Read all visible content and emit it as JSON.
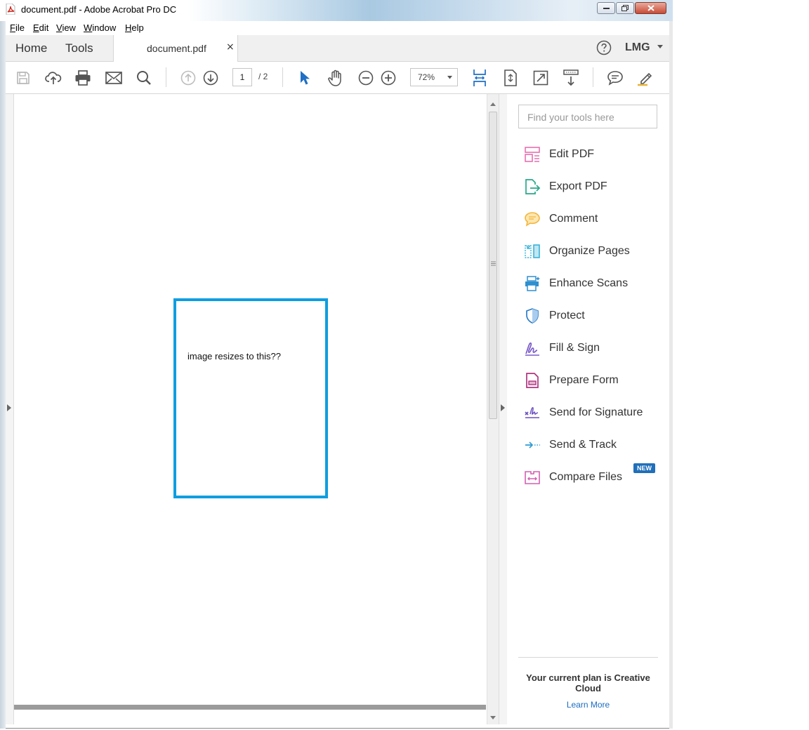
{
  "window": {
    "title": "document.pdf - Adobe Acrobat Pro DC"
  },
  "menu": [
    "File",
    "Edit",
    "View",
    "Window",
    "Help"
  ],
  "tabs": {
    "home": "Home",
    "tools": "Tools",
    "document_tab": "document.pdf",
    "close_glyph": "×",
    "user": "LMG"
  },
  "toolbar": {
    "page_current": "1",
    "page_total": "/ 2",
    "zoom": "72%",
    "icons": [
      "save-icon",
      "cloud-upload-icon",
      "print-icon",
      "email-icon",
      "search-icon",
      "page-up-icon",
      "page-down-icon",
      "select-arrow-icon",
      "hand-icon",
      "zoom-out-icon",
      "zoom-in-icon",
      "fit-width-icon",
      "fit-page-icon",
      "full-screen-icon",
      "scroll-mode-icon",
      "comment-icon",
      "highlight-pen-icon"
    ]
  },
  "document": {
    "page_text": "image resizes to this??",
    "frame_color": "#0e9ee0"
  },
  "tools_pane": {
    "search_placeholder": "Find your tools here",
    "items": [
      {
        "label": "Edit PDF",
        "icon": "edit-pdf-icon",
        "color": "#e86fb1"
      },
      {
        "label": "Export PDF",
        "icon": "export-pdf-icon",
        "color": "#2aa88a"
      },
      {
        "label": "Comment",
        "icon": "comment-bubble-icon",
        "color": "#f3b53c"
      },
      {
        "label": "Organize Pages",
        "icon": "organize-pages-icon",
        "color": "#3ab3d9"
      },
      {
        "label": "Enhance Scans",
        "icon": "enhance-scans-icon",
        "color": "#2f8fcf"
      },
      {
        "label": "Protect",
        "icon": "shield-icon",
        "color": "#2c7dc8"
      },
      {
        "label": "Fill & Sign",
        "icon": "fill-sign-icon",
        "color": "#7a5cc8"
      },
      {
        "label": "Prepare Form",
        "icon": "prepare-form-icon",
        "color": "#b0347f"
      },
      {
        "label": "Send for Signature",
        "icon": "send-signature-icon",
        "color": "#6b4fc2"
      },
      {
        "label": "Send & Track",
        "icon": "send-track-icon",
        "color": "#2f9bd3"
      },
      {
        "label": "Compare Files",
        "icon": "compare-files-icon",
        "color": "#d35fb3"
      }
    ],
    "new_badge": "NEW",
    "plan_text": "Your current plan is Creative Cloud",
    "learn_more": "Learn More"
  }
}
